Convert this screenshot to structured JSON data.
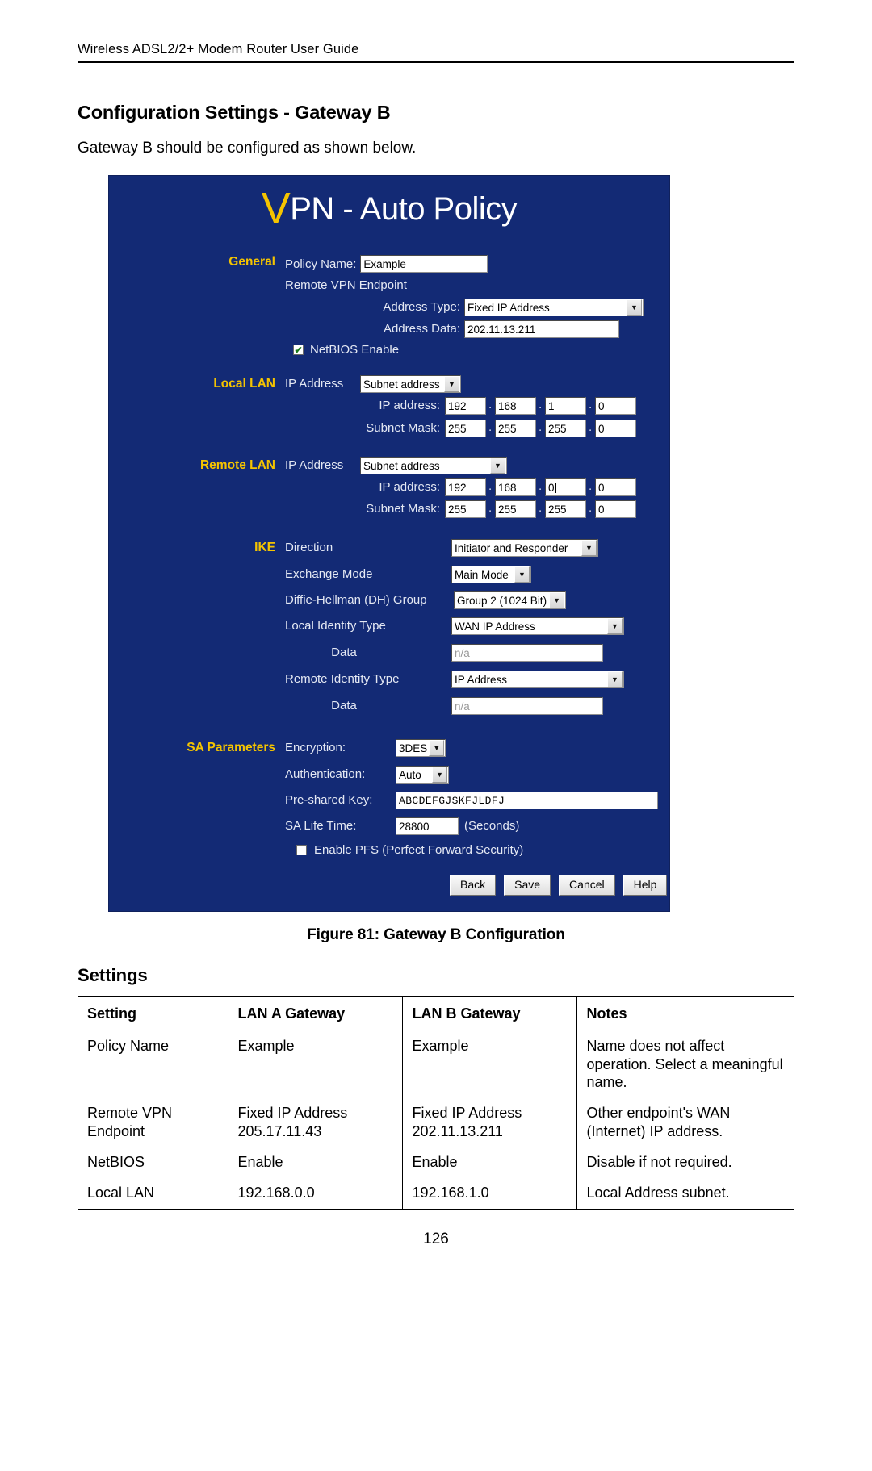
{
  "document": {
    "running_header": "Wireless ADSL2/2+ Modem Router User Guide",
    "section_title": "Configuration Settings - Gateway B",
    "lead": "Gateway B should be configured as shown below.",
    "figure_caption": "Figure 81: Gateway B Configuration",
    "settings_heading": "Settings",
    "page_number": "126"
  },
  "colors": {
    "panel_bg": "#132a75",
    "group_label": "#f5c400",
    "field_label": "#e4e8f3",
    "title_text": "#ffffff"
  },
  "screenshot": {
    "title_initial": "V",
    "title_rest": "PN - Auto Policy",
    "groups": {
      "general": "General",
      "local_lan": "Local LAN",
      "remote_lan": "Remote LAN",
      "ike": "IKE",
      "sa_parameters": "SA Parameters"
    },
    "general": {
      "policy_name_label": "Policy Name:",
      "policy_name_value": "Example",
      "remote_vpn_endpoint_label": "Remote VPN Endpoint",
      "address_type_label": "Address Type:",
      "address_type_value": "Fixed IP Address",
      "address_data_label": "Address Data:",
      "address_data_value": "202.11.13.211",
      "netbios_label": "NetBIOS Enable",
      "netbios_checked": "✔"
    },
    "local_lan": {
      "ip_address_label": "IP Address",
      "ip_address_type": "Subnet address",
      "ip_row_label": "IP address:",
      "ip_octets": [
        "192",
        "168",
        "1",
        "0"
      ],
      "mask_row_label": "Subnet Mask:",
      "mask_octets": [
        "255",
        "255",
        "255",
        "0"
      ]
    },
    "remote_lan": {
      "ip_address_label": "IP Address",
      "ip_address_type": "Subnet address",
      "ip_row_label": "IP address:",
      "ip_octets": [
        "192",
        "168",
        "0",
        "0"
      ],
      "mask_row_label": "Subnet Mask:",
      "mask_octets": [
        "255",
        "255",
        "255",
        "0"
      ]
    },
    "ike": {
      "direction_label": "Direction",
      "direction_value": "Initiator and Responder",
      "exchange_mode_label": "Exchange Mode",
      "exchange_mode_value": "Main Mode",
      "dh_group_label": "Diffie-Hellman (DH) Group",
      "dh_group_value": "Group 2 (1024 Bit)",
      "local_identity_type_label": "Local Identity Type",
      "local_identity_type_value": "WAN IP Address",
      "local_identity_data_label": "Data",
      "local_identity_data_placeholder": "n/a",
      "remote_identity_type_label": "Remote Identity Type",
      "remote_identity_type_value": "IP Address",
      "remote_identity_data_label": "Data",
      "remote_identity_data_placeholder": "n/a"
    },
    "sa": {
      "encryption_label": "Encryption:",
      "encryption_value": "3DES",
      "authentication_label": "Authentication:",
      "authentication_value": "Auto",
      "preshared_key_label": "Pre-shared Key:",
      "preshared_key_value": "ABCDEFGJSKFJLDFJ",
      "sa_life_time_label": "SA Life Time:",
      "sa_life_time_value": "28800",
      "sa_life_time_units": "(Seconds)",
      "pfs_label": "Enable PFS (Perfect Forward Security)"
    },
    "buttons": {
      "back": "Back",
      "save": "Save",
      "cancel": "Cancel",
      "help": "Help"
    }
  },
  "settings_table": {
    "headers": [
      "Setting",
      "LAN A Gateway",
      "LAN B Gateway",
      "Notes"
    ],
    "rows": [
      {
        "setting": "Policy Name",
        "lan_a": "Example",
        "lan_b": "Example",
        "notes": "Name does not affect operation. Select a meaningful name."
      },
      {
        "setting": "Remote VPN Endpoint",
        "lan_a": "Fixed IP Address 205.17.11.43",
        "lan_b": "Fixed IP Address 202.11.13.211",
        "notes": "Other endpoint's WAN (Internet) IP address."
      },
      {
        "setting": "NetBIOS",
        "lan_a": "Enable",
        "lan_b": "Enable",
        "notes": "Disable if not required."
      },
      {
        "setting": "Local LAN",
        "lan_a": "192.168.0.0",
        "lan_b": "192.168.1.0",
        "notes": "Local Address subnet."
      }
    ]
  }
}
